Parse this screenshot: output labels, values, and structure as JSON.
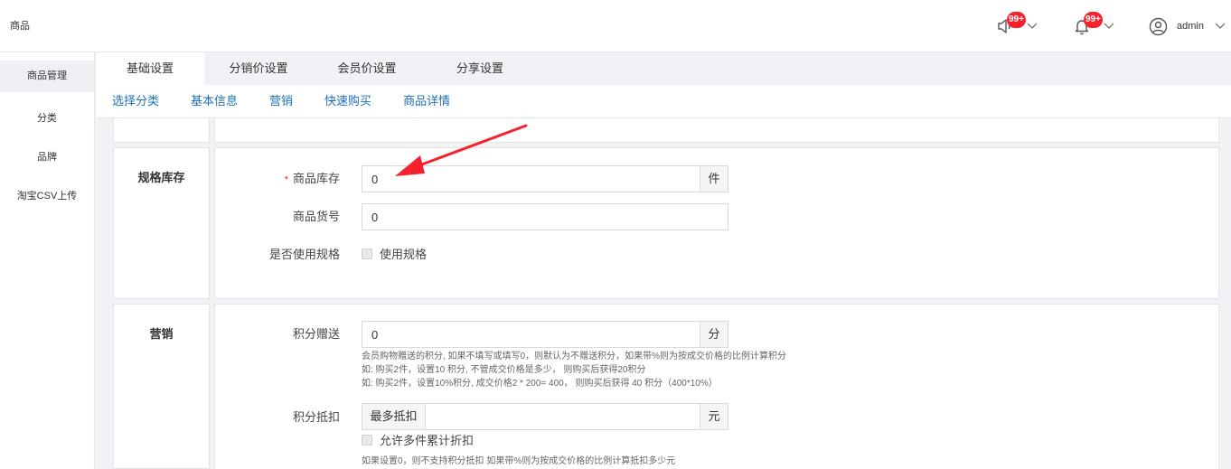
{
  "header": {
    "app_title": "商品",
    "speaker_badge": "99+",
    "bell_badge": "99+",
    "user_name": "admin"
  },
  "sidebar": {
    "items": [
      {
        "label": "商品管理"
      },
      {
        "label": "分类"
      },
      {
        "label": "品牌"
      },
      {
        "label": "淘宝CSV上传"
      }
    ]
  },
  "tabs": [
    {
      "label": "基础设置"
    },
    {
      "label": "分销价设置"
    },
    {
      "label": "会员价设置"
    },
    {
      "label": "分享设置"
    }
  ],
  "anchors": [
    {
      "label": "选择分类"
    },
    {
      "label": "基本信息"
    },
    {
      "label": "营销"
    },
    {
      "label": "快速购买"
    },
    {
      "label": "商品详情"
    }
  ],
  "spec_stock": {
    "section_title": "规格库存",
    "required_mark": "*",
    "stock_label": "商品库存",
    "stock_value": "0",
    "stock_unit": "件",
    "sku_label": "商品货号",
    "sku_value": "0",
    "use_spec_label": "是否使用规格",
    "use_spec_checkbox": "使用规格"
  },
  "marketing": {
    "section_title": "营销",
    "points_label": "积分赠送",
    "points_value": "0",
    "points_unit": "分",
    "points_help": [
      "会员购物赠送的积分, 如果不填写或填写0，则默认为不赠送积分，如果带%则为按成交价格的比例计算积分",
      "如: 购买2件，设置10 积分, 不管成交价格是多少， 则购买后获得20积分",
      "如: 购买2件，设置10%积分, 成交价格2 * 200= 400， 则购买后获得 40 积分（400*10%）"
    ],
    "deduct_label": "积分抵扣",
    "deduct_prefix": "最多抵扣",
    "deduct_value": "",
    "deduct_unit": "元",
    "allow_multi_label": "允许多件累计折扣",
    "deduct_help": "如果设置0，则不支持积分抵扣 如果带%则为按成交价格的比例计算抵扣多少元"
  },
  "colors": {
    "accent_link": "#1e6fb8",
    "badge": "#f5222d",
    "annotation_arrow": "#f5222d"
  }
}
